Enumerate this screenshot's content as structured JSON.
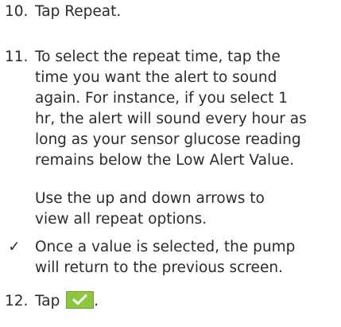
{
  "step10": {
    "number": "10.",
    "prefix": "Tap ",
    "action": "Repeat",
    "suffix": "."
  },
  "step11": {
    "number": "11.",
    "lines": [
      "To select the repeat time, tap the",
      "time you want the alert to sound",
      "again. For instance, if you select 1",
      "hr, the alert will sound every hour as",
      "long as your sensor glucose reading",
      "remains below the Low Alert Value."
    ],
    "note_lines": [
      "Use the up and down arrows to",
      "view all repeat options."
    ]
  },
  "result": {
    "marker": "✓",
    "lines": [
      "Once a value is selected, the pump",
      "will return to the previous screen."
    ]
  },
  "step12": {
    "number": "12.",
    "prefix": "Tap",
    "button_icon": "check-icon",
    "button_color": "#8bc73f",
    "suffix": "."
  }
}
